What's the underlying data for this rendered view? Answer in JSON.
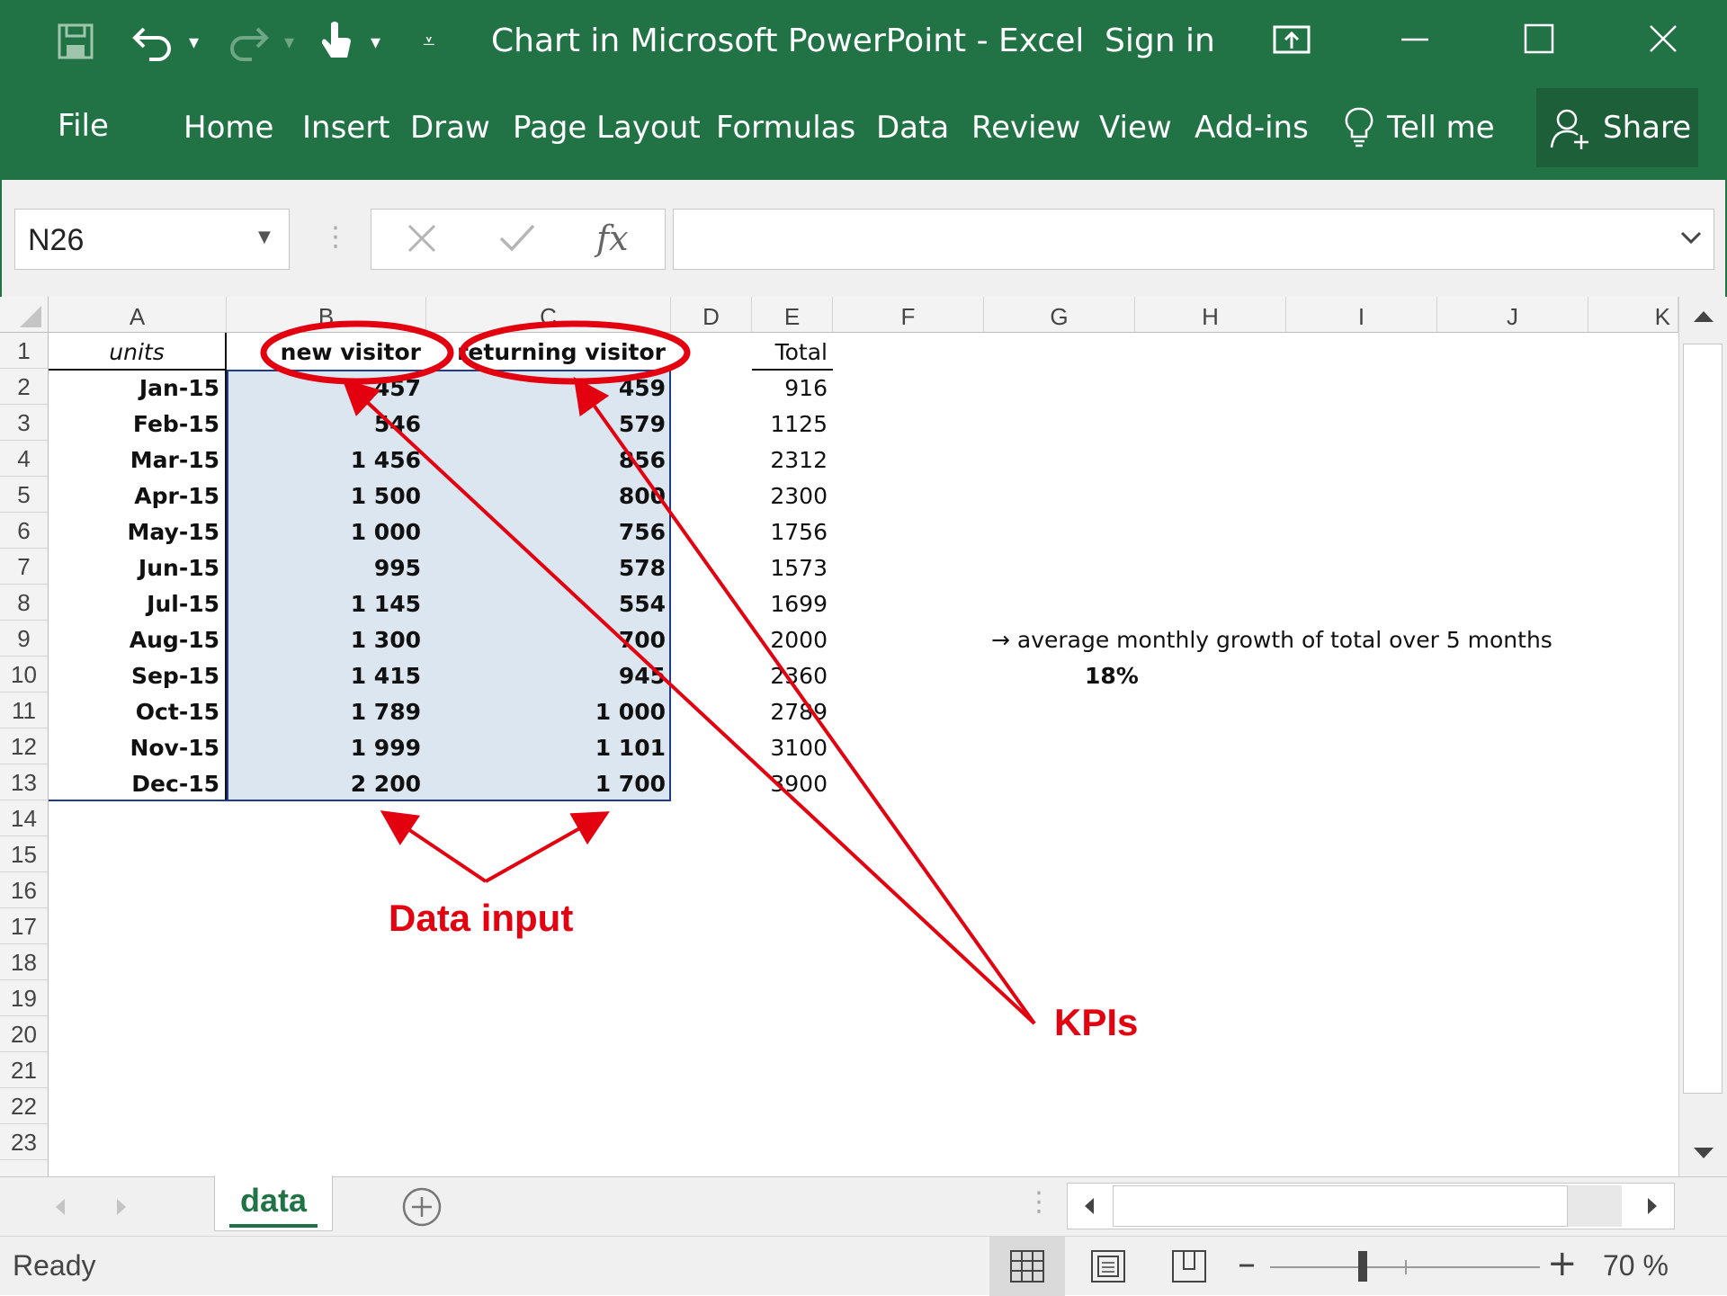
{
  "window": {
    "title": "Chart in Microsoft PowerPoint - Excel",
    "sign_in": "Sign in"
  },
  "ribbon": {
    "tabs": [
      "File",
      "Home",
      "Insert",
      "Draw",
      "Page Layout",
      "Formulas",
      "Data",
      "Review",
      "View",
      "Add-ins"
    ],
    "tell_me": "Tell me",
    "share": "Share"
  },
  "formula_bar": {
    "name_box": "N26",
    "fx": "fx",
    "content": ""
  },
  "grid": {
    "columns": [
      "A",
      "B",
      "C",
      "D",
      "E",
      "F",
      "G",
      "H",
      "I",
      "J",
      "K"
    ],
    "rows": [
      "1",
      "2",
      "3",
      "4",
      "5",
      "6",
      "7",
      "8",
      "9",
      "10",
      "11",
      "12",
      "13",
      "14",
      "15",
      "16",
      "17",
      "18",
      "19",
      "20",
      "21",
      "22",
      "23"
    ],
    "header": {
      "units": "units",
      "new_visitor": "new visitor",
      "returning_visitor": "returning visitor",
      "total": "Total"
    },
    "data": [
      {
        "month": "Jan-15",
        "new": "457",
        "ret": "459",
        "total": "916"
      },
      {
        "month": "Feb-15",
        "new": "546",
        "ret": "579",
        "total": "1125"
      },
      {
        "month": "Mar-15",
        "new": "1 456",
        "ret": "856",
        "total": "2312"
      },
      {
        "month": "Apr-15",
        "new": "1 500",
        "ret": "800",
        "total": "2300"
      },
      {
        "month": "May-15",
        "new": "1 000",
        "ret": "756",
        "total": "1756"
      },
      {
        "month": "Jun-15",
        "new": "995",
        "ret": "578",
        "total": "1573"
      },
      {
        "month": "Jul-15",
        "new": "1 145",
        "ret": "554",
        "total": "1699"
      },
      {
        "month": "Aug-15",
        "new": "1 300",
        "ret": "700",
        "total": "2000"
      },
      {
        "month": "Sep-15",
        "new": "1 415",
        "ret": "945",
        "total": "2360"
      },
      {
        "month": "Oct-15",
        "new": "1 789",
        "ret": "1 000",
        "total": "2789"
      },
      {
        "month": "Nov-15",
        "new": "1 999",
        "ret": "1 101",
        "total": "3100"
      },
      {
        "month": "Dec-15",
        "new": "2 200",
        "ret": "1 700",
        "total": "3900"
      }
    ],
    "growth_note": "→ average monthly growth of total over 5 months",
    "growth_value": "18%"
  },
  "annotations": {
    "data_input": "Data input",
    "kpis": "KPIs",
    "color": "#e3000f"
  },
  "sheet_tabs": {
    "active": "data"
  },
  "status": {
    "ready": "Ready",
    "zoom": "70 %"
  },
  "colors": {
    "excel_green": "#217346",
    "selection_fill": "#dce6f1",
    "selection_border": "#203a8c"
  }
}
